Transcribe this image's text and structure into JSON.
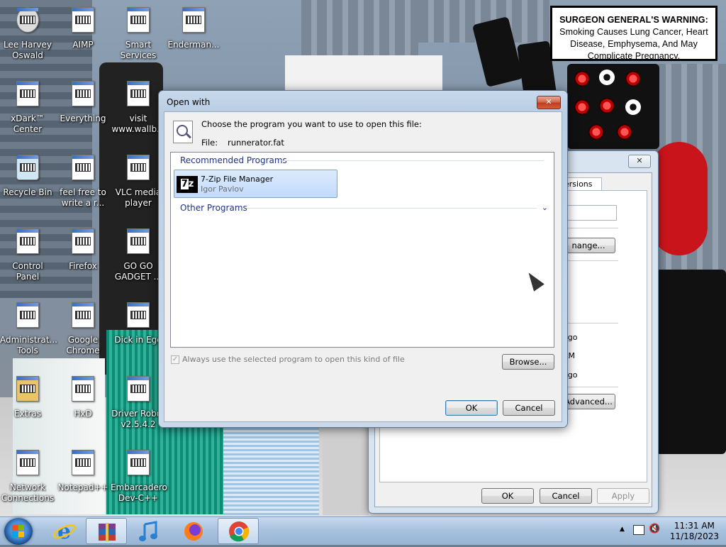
{
  "warning": {
    "bold": "SURGEON GENERAL'S WARNING:",
    "text": "Smoking Causes Lung Cancer, Heart Disease, Emphysema, And May Complicate Pregnancy."
  },
  "desktop_icons": [
    {
      "label": "Lee Harvey Oswald",
      "icon": "person-icon"
    },
    {
      "label": "AIMP",
      "icon": "app-icon"
    },
    {
      "label": "Smart Services",
      "icon": "app-icon"
    },
    {
      "label": "Enderman...",
      "icon": "app-icon"
    },
    {
      "label": "xDark™ Center",
      "icon": "speaker-icon"
    },
    {
      "label": "Everything",
      "icon": "app-icon"
    },
    {
      "label": "visit www.wallb...",
      "icon": "document-icon"
    },
    {
      "label": "Recycle Bin",
      "icon": "recycle-bin-icon"
    },
    {
      "label": "feel free to write a r...",
      "icon": "document-icon"
    },
    {
      "label": "VLC media player",
      "icon": "app-icon"
    },
    {
      "label": "Control Panel",
      "icon": "control-panel-icon"
    },
    {
      "label": "Firefox",
      "icon": "app-icon"
    },
    {
      "label": "GO GO GADGET ...",
      "icon": "app-icon"
    },
    {
      "label": "Administrat... Tools",
      "icon": "admin-tools-icon"
    },
    {
      "label": "Google Chrome",
      "icon": "app-icon"
    },
    {
      "label": "Dick in Ego",
      "icon": "app-icon"
    },
    {
      "label": "Extras",
      "icon": "folder-icon"
    },
    {
      "label": "HxD",
      "icon": "app-icon"
    },
    {
      "label": "Driver Robot v2.5.4.2",
      "icon": "app-icon"
    },
    {
      "label": "Network Connections",
      "icon": "network-icon"
    },
    {
      "label": "Notepad++",
      "icon": "app-icon"
    },
    {
      "label": "Embarcadero Dev-C++",
      "icon": "app-icon"
    }
  ],
  "properties_dialog": {
    "tab_fragment": "ersions",
    "change_btn_fragment": "nange...",
    "text_frags": [
      "o",
      "ago",
      "AM",
      "ago"
    ],
    "advanced_btn_fragment": "Advanced...",
    "ok": "OK",
    "cancel": "Cancel",
    "apply": "Apply"
  },
  "open_with": {
    "title": "Open with",
    "close": "✕",
    "prompt": "Choose the program you want to use to open this file:",
    "file_label": "File:",
    "file_name": "runnerator.fat",
    "recommended_header": "Recommended Programs",
    "program_name": "7-Zip File Manager",
    "program_publisher": "Igor Pavlov",
    "other_header": "Other Programs",
    "chevron": "⌄",
    "always_use": "Always use the selected program to open this kind of file",
    "browse": "Browse...",
    "ok": "OK",
    "cancel": "Cancel"
  },
  "taskbar": {
    "items": [
      {
        "name": "internet-explorer-icon"
      },
      {
        "name": "winrar-icon",
        "active": true
      },
      {
        "name": "music-icon"
      },
      {
        "name": "firefox-icon"
      },
      {
        "name": "chrome-icon"
      }
    ],
    "time": "11:31 AM",
    "date": "11/18/2023"
  }
}
